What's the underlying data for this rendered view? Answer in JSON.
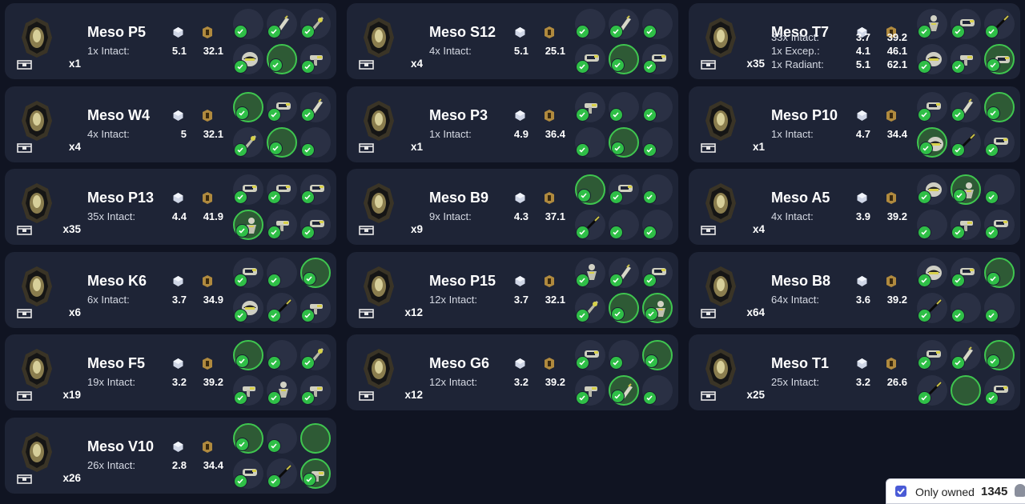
{
  "footer": {
    "only_owned_label": "Only owned",
    "count": "1345",
    "only_owned_checked": true
  },
  "relics": [
    {
      "name": "Meso P5",
      "qty": "x1",
      "rows": [
        {
          "label": "1x Intact:",
          "plat": "5.1",
          "ducats": "32.1"
        }
      ],
      "parts": [
        {
          "pic": "none",
          "owned": true
        },
        {
          "pic": "blade",
          "owned": true
        },
        {
          "pic": "stock",
          "owned": true
        },
        {
          "pic": "helmet",
          "owned": true
        },
        {
          "pic": "none",
          "owned": true,
          "full": true
        },
        {
          "pic": "gun",
          "owned": true
        }
      ]
    },
    {
      "name": "Meso S12",
      "qty": "x4",
      "rows": [
        {
          "label": "4x Intact:",
          "plat": "5.1",
          "ducats": "25.1"
        }
      ],
      "parts": [
        {
          "pic": "none",
          "owned": true
        },
        {
          "pic": "blade",
          "owned": true
        },
        {
          "pic": "none",
          "owned": true
        },
        {
          "pic": "barrel",
          "owned": true
        },
        {
          "pic": "none",
          "owned": true,
          "full": true
        },
        {
          "pic": "barrel",
          "owned": true
        }
      ]
    },
    {
      "name": "Meso T7",
      "qty": "x35",
      "rows": [
        {
          "label": "33x Intact:",
          "plat": "3.7",
          "ducats": "39.2"
        },
        {
          "label": "1x Excep.:",
          "plat": "4.1",
          "ducats": "46.1"
        },
        {
          "label": "1x Radiant:",
          "plat": "5.1",
          "ducats": "62.1"
        }
      ],
      "parts": [
        {
          "pic": "figure",
          "owned": true
        },
        {
          "pic": "barrel",
          "owned": true
        },
        {
          "pic": "stick",
          "owned": true
        },
        {
          "pic": "helmet",
          "owned": true
        },
        {
          "pic": "gun",
          "owned": true
        },
        {
          "pic": "barrel",
          "owned": true,
          "full": true
        }
      ]
    },
    {
      "name": "Meso W4",
      "qty": "x4",
      "rows": [
        {
          "label": "4x Intact:",
          "plat": "5",
          "ducats": "32.1"
        }
      ],
      "parts": [
        {
          "pic": "none",
          "owned": true,
          "full": true
        },
        {
          "pic": "barrel",
          "owned": true
        },
        {
          "pic": "blade",
          "owned": true
        },
        {
          "pic": "stock",
          "owned": true
        },
        {
          "pic": "none",
          "owned": true,
          "full": true
        },
        {
          "pic": "none",
          "owned": true
        }
      ]
    },
    {
      "name": "Meso P3",
      "qty": "x1",
      "rows": [
        {
          "label": "1x Intact:",
          "plat": "4.9",
          "ducats": "36.4"
        }
      ],
      "parts": [
        {
          "pic": "gun",
          "owned": true
        },
        {
          "pic": "none",
          "owned": true
        },
        {
          "pic": "none",
          "owned": true
        },
        {
          "pic": "none",
          "owned": true
        },
        {
          "pic": "none",
          "owned": true,
          "full": true
        },
        {
          "pic": "none",
          "owned": true
        }
      ]
    },
    {
      "name": "Meso P10",
      "qty": "x1",
      "rows": [
        {
          "label": "1x Intact:",
          "plat": "4.7",
          "ducats": "34.4"
        }
      ],
      "parts": [
        {
          "pic": "barrel",
          "owned": true
        },
        {
          "pic": "blade",
          "owned": true
        },
        {
          "pic": "none",
          "owned": true,
          "full": true
        },
        {
          "pic": "helmet",
          "owned": true,
          "full": true
        },
        {
          "pic": "stick",
          "owned": true
        },
        {
          "pic": "barrel",
          "owned": true
        }
      ]
    },
    {
      "name": "Meso P13",
      "qty": "x35",
      "rows": [
        {
          "label": "35x Intact:",
          "plat": "4.4",
          "ducats": "41.9"
        }
      ],
      "parts": [
        {
          "pic": "barrel",
          "owned": true
        },
        {
          "pic": "barrel",
          "owned": true
        },
        {
          "pic": "barrel",
          "owned": true
        },
        {
          "pic": "figure",
          "owned": true,
          "full": true
        },
        {
          "pic": "gun",
          "owned": true
        },
        {
          "pic": "barrel",
          "owned": true
        }
      ]
    },
    {
      "name": "Meso B9",
      "qty": "x9",
      "rows": [
        {
          "label": "9x Intact:",
          "plat": "4.3",
          "ducats": "37.1"
        }
      ],
      "parts": [
        {
          "pic": "none",
          "owned": true,
          "full": true
        },
        {
          "pic": "barrel",
          "owned": true
        },
        {
          "pic": "none",
          "owned": true
        },
        {
          "pic": "stick",
          "owned": true
        },
        {
          "pic": "none",
          "owned": true
        },
        {
          "pic": "none",
          "owned": true
        }
      ]
    },
    {
      "name": "Meso A5",
      "qty": "x4",
      "rows": [
        {
          "label": "4x Intact:",
          "plat": "3.9",
          "ducats": "39.2"
        }
      ],
      "parts": [
        {
          "pic": "helmet",
          "owned": true
        },
        {
          "pic": "figure",
          "owned": true,
          "full": true
        },
        {
          "pic": "none",
          "owned": true
        },
        {
          "pic": "none",
          "owned": true
        },
        {
          "pic": "gun",
          "owned": true
        },
        {
          "pic": "barrel",
          "owned": true
        }
      ]
    },
    {
      "name": "Meso K6",
      "qty": "x6",
      "rows": [
        {
          "label": "6x Intact:",
          "plat": "3.7",
          "ducats": "34.9"
        }
      ],
      "parts": [
        {
          "pic": "barrel",
          "owned": true
        },
        {
          "pic": "none",
          "owned": true
        },
        {
          "pic": "none",
          "owned": true,
          "full": true
        },
        {
          "pic": "helmet",
          "owned": true
        },
        {
          "pic": "stick",
          "owned": true
        },
        {
          "pic": "gun",
          "owned": true
        }
      ]
    },
    {
      "name": "Meso P15",
      "qty": "x12",
      "rows": [
        {
          "label": "12x Intact:",
          "plat": "3.7",
          "ducats": "32.1"
        }
      ],
      "parts": [
        {
          "pic": "figure",
          "owned": true
        },
        {
          "pic": "blade",
          "owned": true
        },
        {
          "pic": "barrel",
          "owned": true
        },
        {
          "pic": "stock",
          "owned": true
        },
        {
          "pic": "none",
          "owned": true,
          "full": true
        },
        {
          "pic": "figure",
          "owned": true,
          "full": true
        }
      ]
    },
    {
      "name": "Meso B8",
      "qty": "x64",
      "rows": [
        {
          "label": "64x Intact:",
          "plat": "3.6",
          "ducats": "39.2"
        }
      ],
      "parts": [
        {
          "pic": "helmet",
          "owned": true
        },
        {
          "pic": "barrel",
          "owned": true
        },
        {
          "pic": "none",
          "owned": true,
          "full": true
        },
        {
          "pic": "stick",
          "owned": true
        },
        {
          "pic": "none",
          "owned": true
        },
        {
          "pic": "none",
          "owned": true
        }
      ]
    },
    {
      "name": "Meso F5",
      "qty": "x19",
      "rows": [
        {
          "label": "19x Intact:",
          "plat": "3.2",
          "ducats": "39.2"
        }
      ],
      "parts": [
        {
          "pic": "none",
          "owned": true,
          "full": true
        },
        {
          "pic": "none",
          "owned": true
        },
        {
          "pic": "stock",
          "owned": true
        },
        {
          "pic": "gun",
          "owned": true
        },
        {
          "pic": "figure",
          "owned": true
        },
        {
          "pic": "gun",
          "owned": true
        }
      ]
    },
    {
      "name": "Meso G6",
      "qty": "x12",
      "rows": [
        {
          "label": "12x Intact:",
          "plat": "3.2",
          "ducats": "39.2"
        }
      ],
      "parts": [
        {
          "pic": "barrel",
          "owned": true
        },
        {
          "pic": "none",
          "owned": true
        },
        {
          "pic": "none",
          "owned": true,
          "full": true
        },
        {
          "pic": "gun",
          "owned": true
        },
        {
          "pic": "blade",
          "owned": true,
          "full": true
        },
        {
          "pic": "none",
          "owned": true
        }
      ]
    },
    {
      "name": "Meso T1",
      "qty": "x25",
      "rows": [
        {
          "label": "25x Intact:",
          "plat": "3.2",
          "ducats": "26.6"
        }
      ],
      "parts": [
        {
          "pic": "barrel",
          "owned": true
        },
        {
          "pic": "blade",
          "owned": true
        },
        {
          "pic": "none",
          "owned": true,
          "full": true
        },
        {
          "pic": "stick",
          "owned": true
        },
        {
          "pic": "none",
          "owned": false,
          "full": true
        },
        {
          "pic": "barrel",
          "owned": true
        }
      ]
    },
    {
      "name": "Meso V10",
      "qty": "x26",
      "rows": [
        {
          "label": "26x Intact:",
          "plat": "2.8",
          "ducats": "34.4"
        }
      ],
      "parts": [
        {
          "pic": "none",
          "owned": true,
          "full": true
        },
        {
          "pic": "none",
          "owned": true
        },
        {
          "pic": "none",
          "owned": false,
          "full": true
        },
        {
          "pic": "barrel",
          "owned": true
        },
        {
          "pic": "stick",
          "owned": true
        },
        {
          "pic": "gun",
          "owned": true,
          "full": true
        }
      ]
    }
  ]
}
